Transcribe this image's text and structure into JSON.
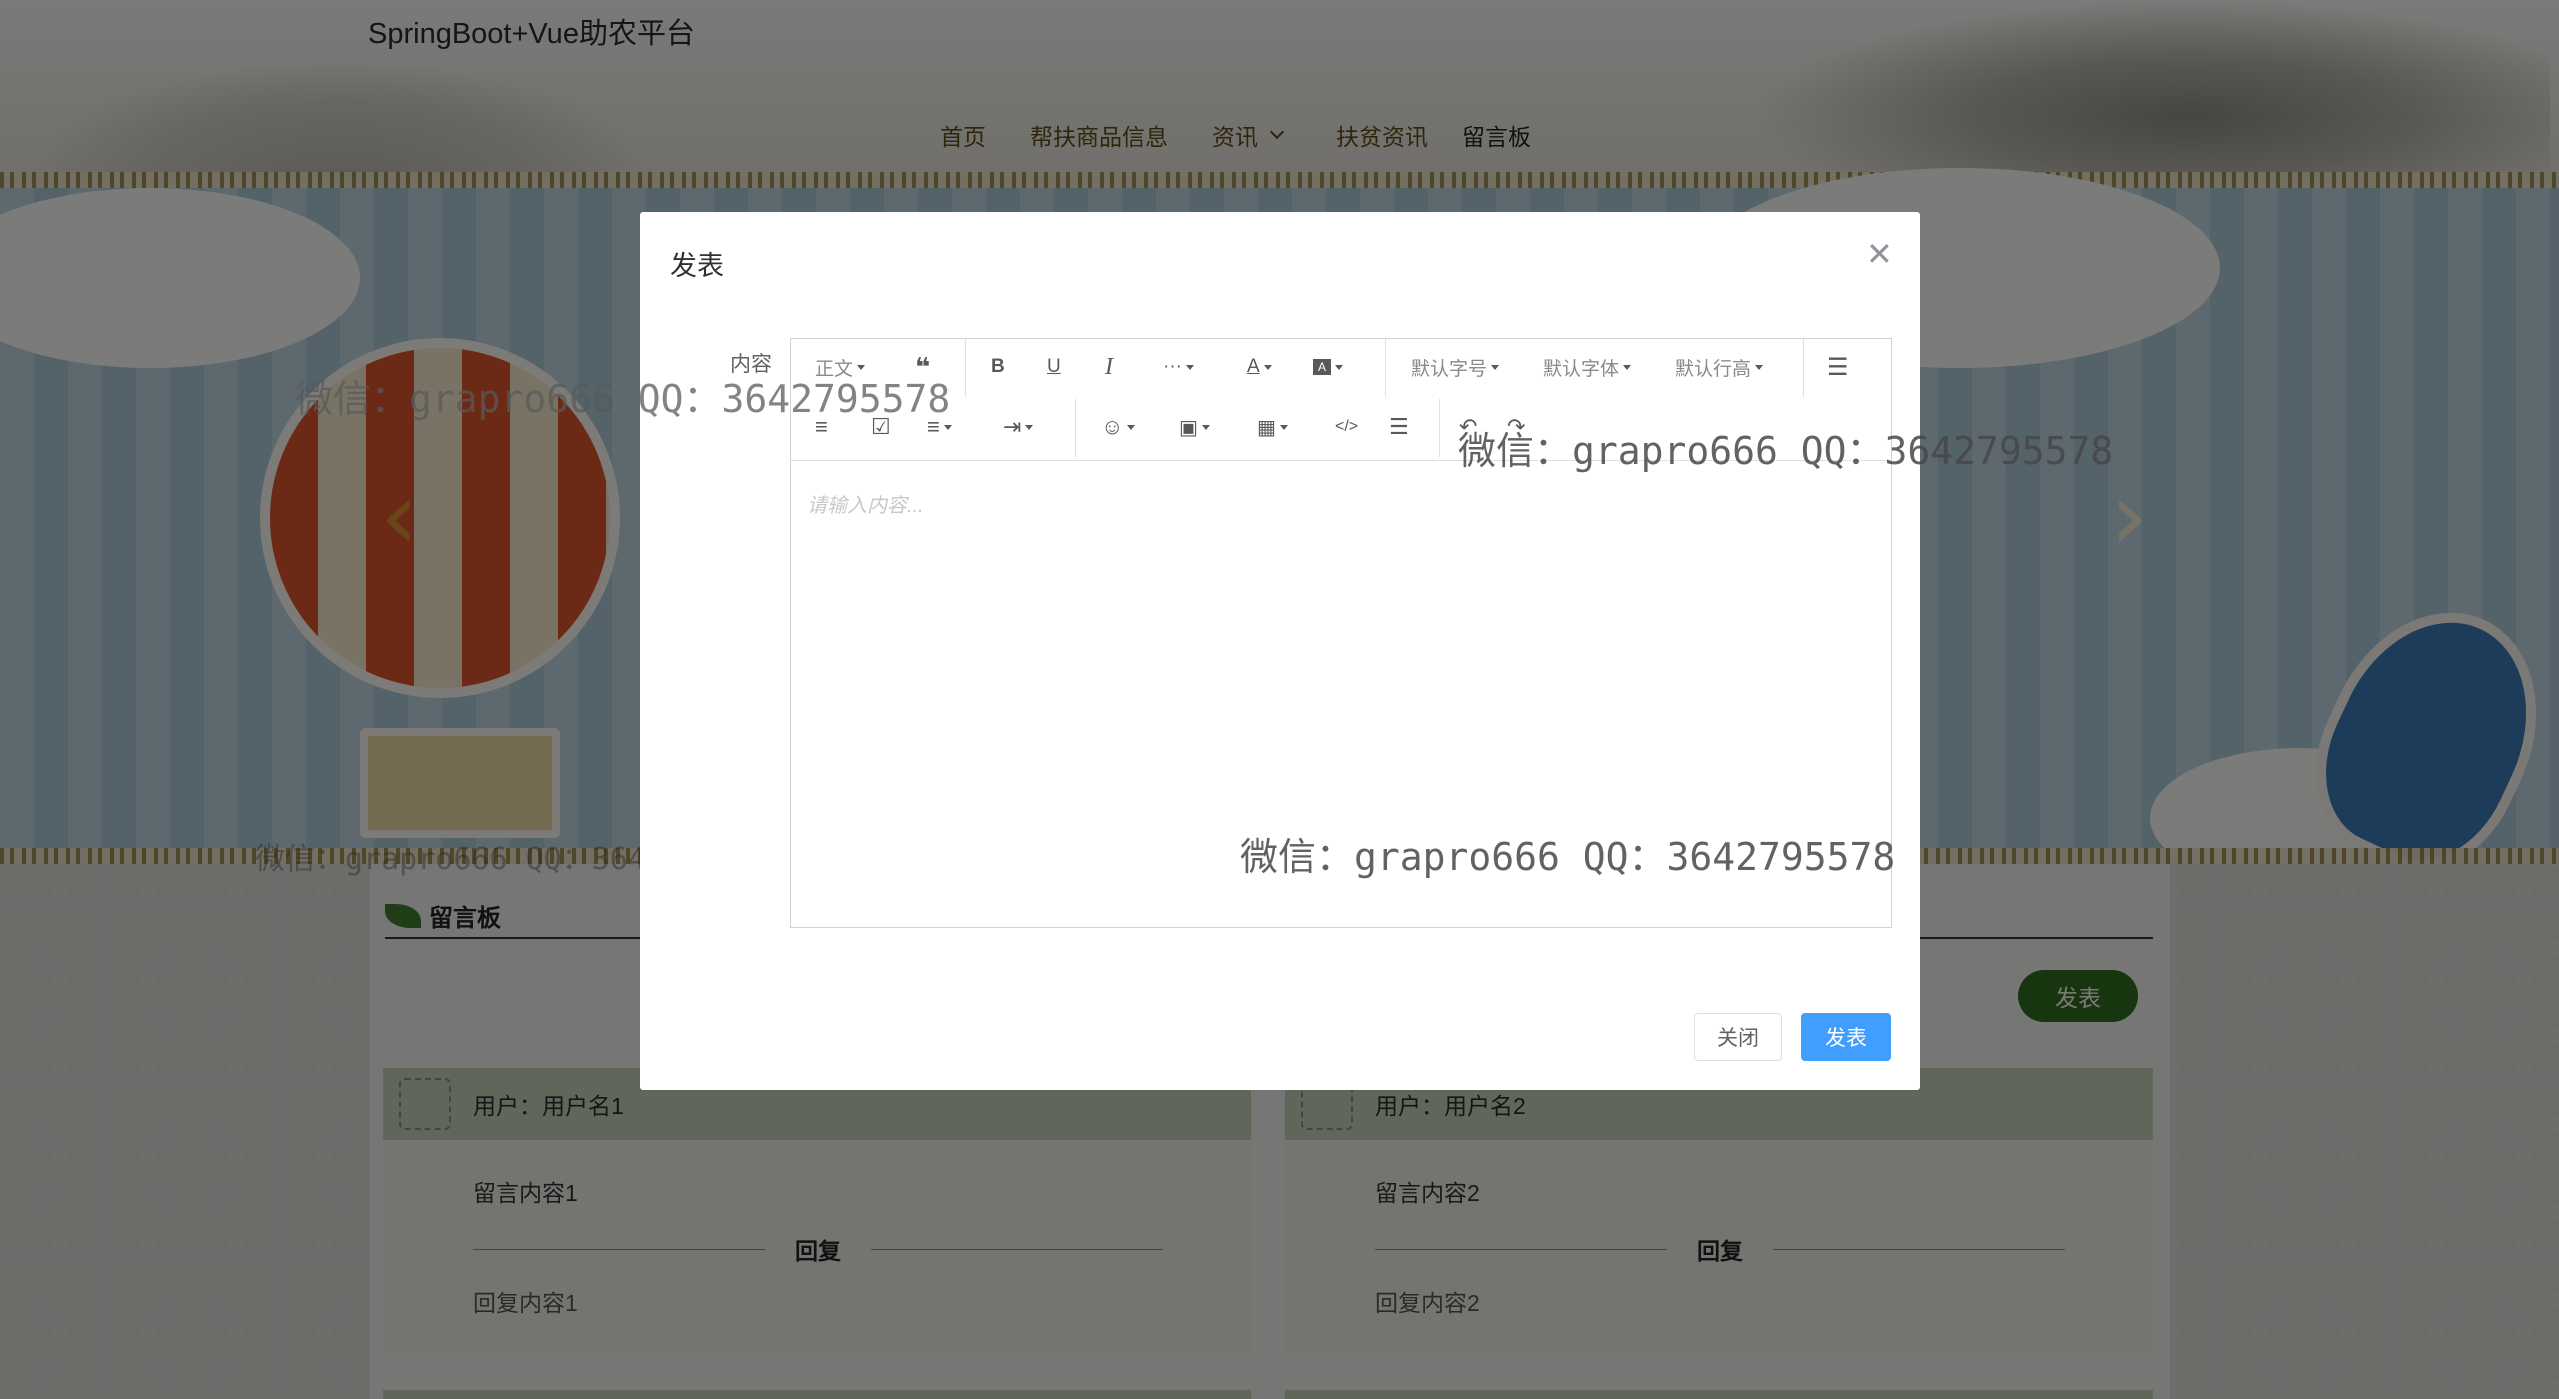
{
  "site": {
    "title": "SpringBoot+Vue助农平台"
  },
  "nav": {
    "items": [
      {
        "label": "首页"
      },
      {
        "label": "帮扶商品信息"
      },
      {
        "label": "资讯"
      },
      {
        "label": "扶贫资讯"
      },
      {
        "label": "留言板"
      }
    ]
  },
  "carousel": {
    "prev_icon": "chevron-left-icon",
    "next_icon": "chevron-right-icon"
  },
  "board": {
    "title": "留言板",
    "post_button": "发表",
    "reply_label": "回复",
    "messages": [
      {
        "user": "用户：用户名1",
        "content": "留言内容1",
        "reply": "回复内容1"
      },
      {
        "user": "用户：用户名2",
        "content": "留言内容2",
        "reply": "回复内容2"
      }
    ]
  },
  "modal": {
    "title": "发表",
    "field_label": "内容",
    "editor": {
      "placeholder": "请输入内容...",
      "toolbar": {
        "heading": "正文",
        "font_size": "默认字号",
        "font_family": "默认字体",
        "line_height": "默认行高",
        "more": "···"
      }
    },
    "close_button": "关闭",
    "submit_button": "发表"
  },
  "watermarks": [
    "微信：grapro666 QQ：3642795578",
    "微信：grapro666 QQ：3642795578",
    "微信：grapro666 QQ：3642795578"
  ],
  "colors": {
    "primary": "#409eff",
    "nav_text": "#5d4a14",
    "board_button": "#2f6b1f"
  }
}
